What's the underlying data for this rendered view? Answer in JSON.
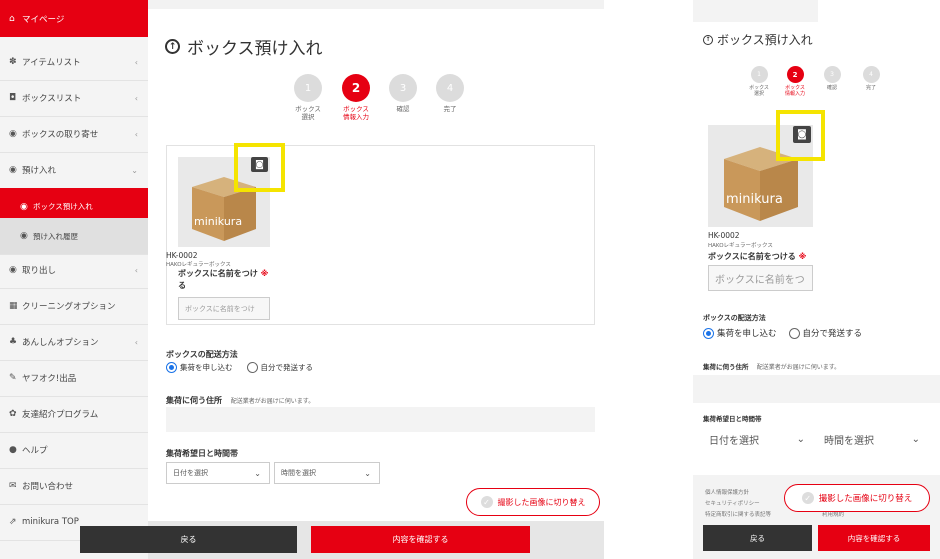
{
  "desktop": {
    "sidebar": {
      "items": [
        {
          "icon": "⌂",
          "label": "マイページ",
          "chevron": ""
        },
        {
          "icon": "✽",
          "label": "アイテムリスト",
          "chevron": "‹"
        },
        {
          "icon": "◘",
          "label": "ボックスリスト",
          "chevron": "‹"
        },
        {
          "icon": "◉",
          "label": "ボックスの取り寄せ",
          "chevron": "‹"
        },
        {
          "icon": "◉",
          "label": "預け入れ",
          "chevron": "⌄"
        },
        {
          "icon": "◉",
          "label": "ボックス預け入れ",
          "chevron": ""
        },
        {
          "icon": "◉",
          "label": "預け入れ履歴",
          "chevron": ""
        },
        {
          "icon": "◉",
          "label": "取り出し",
          "chevron": "‹"
        },
        {
          "icon": "▦",
          "label": "クリーニングオプション",
          "chevron": ""
        },
        {
          "icon": "♣",
          "label": "あんしんオプション",
          "chevron": "‹"
        },
        {
          "icon": "✎",
          "label": "ヤフオク!出品",
          "chevron": ""
        },
        {
          "icon": "✿",
          "label": "友達紹介プログラム",
          "chevron": ""
        },
        {
          "icon": "●",
          "label": "ヘルプ",
          "chevron": ""
        },
        {
          "icon": "✉",
          "label": "お問い合わせ",
          "chevron": ""
        },
        {
          "icon": "⇗",
          "label": "minikura TOP",
          "chevron": ""
        }
      ]
    },
    "title": "ボックス預け入れ",
    "title_icon": "↑",
    "steps": [
      {
        "num": "1",
        "label1": "ボックス",
        "label2": "選択"
      },
      {
        "num": "2",
        "label1": "ボックス",
        "label2": "情報入力"
      },
      {
        "num": "3",
        "label1": "確認",
        "label2": ""
      },
      {
        "num": "4",
        "label1": "完了",
        "label2": ""
      }
    ],
    "box": {
      "brand": "minikura",
      "id": "HK-0002",
      "type": "HAKOレギュラーボックス",
      "name_label_1": "ボックスに名前をつけ",
      "name_label_2": "る",
      "required_mark": "※",
      "name_placeholder": "ボックスに名前をつけ"
    },
    "shipping": {
      "label": "ボックスの配送方法",
      "option_pickup": "集荷を申し込む",
      "option_self": "自分で発送する"
    },
    "address": {
      "label": "集荷に伺う住所",
      "note": "配送業者がお届けに伺います。"
    },
    "datetime": {
      "label": "集荷希望日と時間帯",
      "date_select": "日付を選択",
      "time_select": "時間を選択"
    },
    "swap_button": "撮影した画像に切り替え",
    "back_button": "戻る",
    "confirm_button": "内容を確認する"
  },
  "mobile": {
    "title": "ボックス預け入れ",
    "title_icon": "↑",
    "steps": [
      {
        "num": "1",
        "label1": "ボックス",
        "label2": "選択"
      },
      {
        "num": "2",
        "label1": "ボックス",
        "label2": "情報入力"
      },
      {
        "num": "3",
        "label1": "確認",
        "label2": ""
      },
      {
        "num": "4",
        "label1": "完了",
        "label2": ""
      }
    ],
    "box": {
      "brand": "minikura",
      "id": "HK-0002",
      "type": "HAKOレギュラーボックス",
      "name_label": "ボックスに名前をつける",
      "required_mark": "※",
      "name_placeholder": "ボックスに名前をつ"
    },
    "shipping": {
      "label": "ボックスの配送方法",
      "option_pickup": "集荷を申し込む",
      "option_self": "自分で発送する"
    },
    "address": {
      "label": "集荷に伺う住所",
      "note": "配送業者がお届けに伺います。"
    },
    "datetime": {
      "label": "集荷希望日と時間帯",
      "date_select": "日付を選択",
      "time_select": "時間を選択"
    },
    "legal": {
      "privacy": "個人情報保護方針",
      "security": "セキュリティポリシー",
      "commerce": "特定商取引に関する表記等",
      "terms": "利用規約"
    },
    "swap_button": "撮影した画像に切り替え",
    "back_button": "戻る",
    "confirm_button": "内容を確認する"
  },
  "colors": {
    "accent": "#e60012",
    "highlight": "#f5e400",
    "radio": "#1a73e8"
  }
}
